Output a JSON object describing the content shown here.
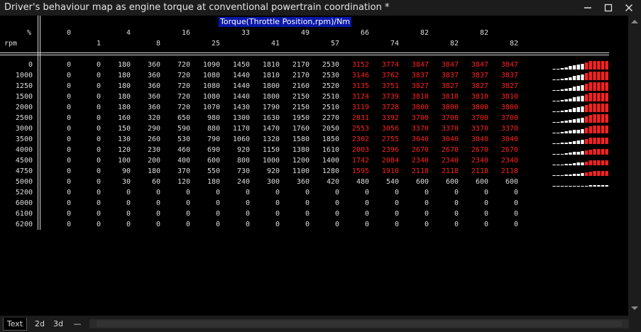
{
  "window": {
    "title": "Driver's behaviour map as engine torque at conventional powertrain coordination *"
  },
  "table": {
    "title": "Torque(Throttle Position,rpm)/Nm",
    "corner_top": "%",
    "corner_bottom": "rpm",
    "col_headers_top": [
      "0",
      "4",
      "16",
      "33",
      "49",
      "66",
      "82",
      "82"
    ],
    "col_headers_bottom": [
      "1",
      "8",
      "25",
      "41",
      "57",
      "74",
      "82",
      "82"
    ],
    "rpm": [
      "0",
      "1000",
      "1250",
      "1500",
      "2000",
      "2500",
      "3000",
      "3500",
      "4000",
      "4500",
      "4750",
      "5000",
      "5200",
      "6000",
      "6100",
      "6200"
    ],
    "rows": [
      [
        "0",
        "0",
        "180",
        "360",
        "720",
        "1090",
        "1450",
        "1810",
        "2170",
        "2530",
        "3152",
        "3774",
        "3847",
        "3847",
        "3847",
        "3847"
      ],
      [
        "0",
        "0",
        "180",
        "360",
        "720",
        "1080",
        "1440",
        "1810",
        "2170",
        "2530",
        "3146",
        "3762",
        "3837",
        "3837",
        "3837",
        "3837"
      ],
      [
        "0",
        "0",
        "180",
        "360",
        "720",
        "1080",
        "1440",
        "1800",
        "2160",
        "2520",
        "3135",
        "3751",
        "3827",
        "3827",
        "3827",
        "3827"
      ],
      [
        "0",
        "0",
        "180",
        "360",
        "720",
        "1080",
        "1440",
        "1800",
        "2150",
        "2510",
        "3124",
        "3739",
        "3810",
        "3810",
        "3810",
        "3810"
      ],
      [
        "0",
        "0",
        "180",
        "360",
        "720",
        "1070",
        "1430",
        "1790",
        "2150",
        "2510",
        "3119",
        "3728",
        "3800",
        "3800",
        "3800",
        "3800"
      ],
      [
        "0",
        "0",
        "160",
        "320",
        "650",
        "980",
        "1300",
        "1630",
        "1950",
        "2270",
        "2831",
        "3392",
        "3700",
        "3700",
        "3700",
        "3700"
      ],
      [
        "0",
        "0",
        "150",
        "290",
        "590",
        "880",
        "1170",
        "1470",
        "1760",
        "2050",
        "2553",
        "3056",
        "3370",
        "3370",
        "3370",
        "3370"
      ],
      [
        "0",
        "0",
        "130",
        "260",
        "530",
        "790",
        "1060",
        "1320",
        "1580",
        "1850",
        "2302",
        "2755",
        "3040",
        "3040",
        "3040",
        "3040"
      ],
      [
        "0",
        "0",
        "120",
        "230",
        "460",
        "690",
        "920",
        "1150",
        "1380",
        "1610",
        "2003",
        "2396",
        "2670",
        "2670",
        "2670",
        "2670"
      ],
      [
        "0",
        "0",
        "100",
        "200",
        "400",
        "600",
        "800",
        "1000",
        "1200",
        "1400",
        "1742",
        "2084",
        "2340",
        "2340",
        "2340",
        "2340"
      ],
      [
        "0",
        "0",
        "90",
        "180",
        "370",
        "550",
        "730",
        "920",
        "1100",
        "1280",
        "1595",
        "1910",
        "2118",
        "2118",
        "2118",
        "2118"
      ],
      [
        "0",
        "0",
        "30",
        "60",
        "120",
        "180",
        "240",
        "300",
        "360",
        "420",
        "480",
        "540",
        "600",
        "600",
        "600",
        "600"
      ],
      [
        "0",
        "0",
        "0",
        "0",
        "0",
        "0",
        "0",
        "0",
        "0",
        "0",
        "0",
        "0",
        "0",
        "0",
        "0",
        "0"
      ],
      [
        "0",
        "0",
        "0",
        "0",
        "0",
        "0",
        "0",
        "0",
        "0",
        "0",
        "0",
        "0",
        "0",
        "0",
        "0",
        "0"
      ],
      [
        "0",
        "0",
        "0",
        "0",
        "0",
        "0",
        "0",
        "0",
        "0",
        "0",
        "0",
        "0",
        "0",
        "0",
        "0",
        "0"
      ],
      [
        "0",
        "0",
        "0",
        "0",
        "0",
        "0",
        "0",
        "0",
        "0",
        "0",
        "0",
        "0",
        "0",
        "0",
        "0",
        "0"
      ]
    ],
    "red_from_column": 10,
    "red_row_count": 11,
    "colors": {
      "normal": "#dddddd",
      "highlight": "#ff2020",
      "title_bg": "#0a18a8"
    }
  },
  "tabs": [
    "Text",
    "2d",
    "3d",
    "—"
  ]
}
